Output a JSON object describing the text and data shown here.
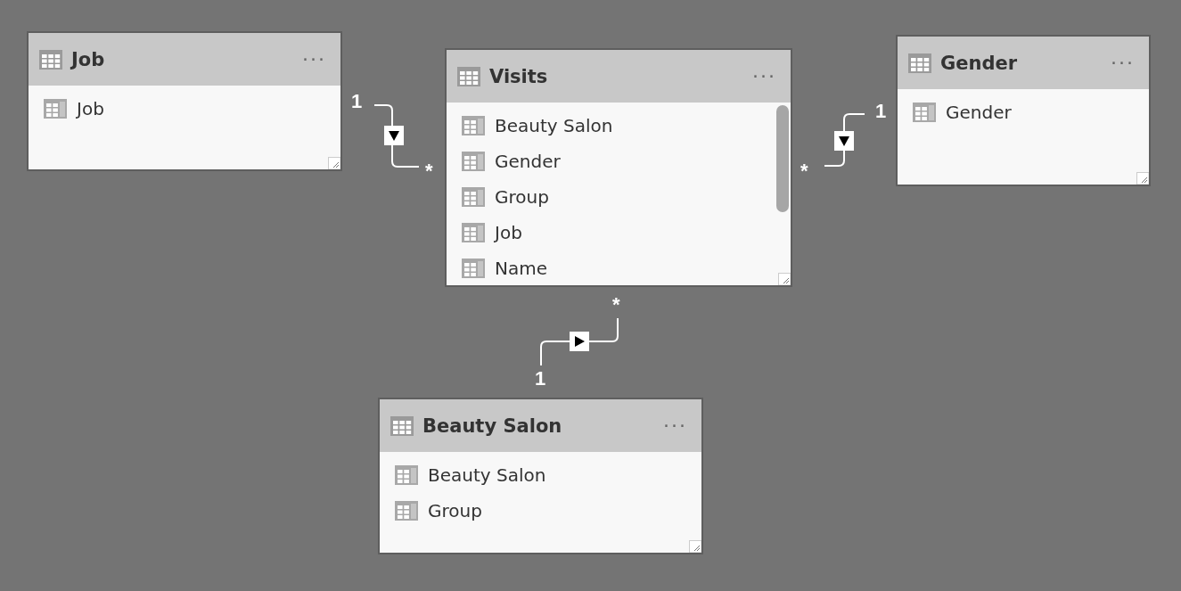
{
  "tables": [
    {
      "name": "Job",
      "menu": "···",
      "scrollbar": false,
      "columns": [
        "Job"
      ]
    },
    {
      "name": "Visits",
      "menu": "···",
      "scrollbar": true,
      "columns": [
        "Beauty Salon",
        "Gender",
        "Group",
        "Job",
        "Name"
      ]
    },
    {
      "name": "Gender",
      "menu": "···",
      "scrollbar": false,
      "columns": [
        "Gender"
      ]
    },
    {
      "name": "Beauty Salon",
      "menu": "···",
      "scrollbar": false,
      "columns": [
        "Beauty Salon",
        "Group"
      ]
    }
  ],
  "relationships": [
    {
      "one_label": "1",
      "many_label": "*",
      "kind": "down"
    },
    {
      "one_label": "1",
      "many_label": "*",
      "kind": "down"
    },
    {
      "one_label": "1",
      "many_label": "*",
      "kind": "right"
    }
  ]
}
